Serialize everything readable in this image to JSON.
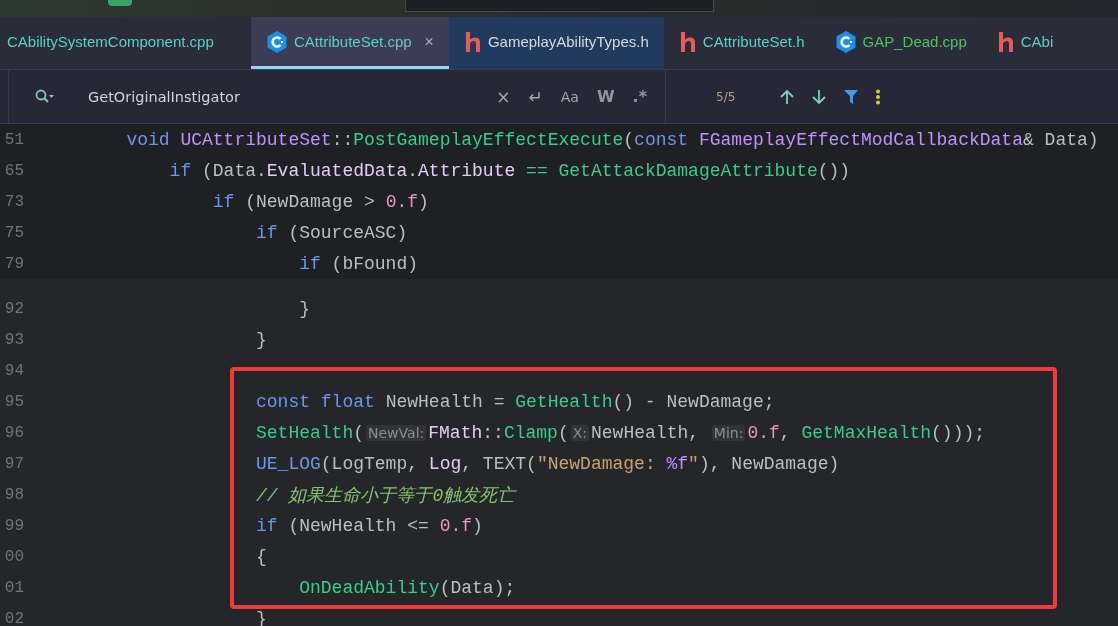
{
  "tabs": [
    {
      "label": "CAbilitySystemComponent.cpp",
      "kind": "plain",
      "selected": false,
      "highlighted": false,
      "color": "#5ccfc4"
    },
    {
      "label": "CAttributeSet.cpp",
      "kind": "cpp",
      "selected": true,
      "highlighted": false,
      "color": "#5ccfc4",
      "close": "×"
    },
    {
      "label": "GameplayAbilityTypes.h",
      "kind": "header",
      "selected": false,
      "highlighted": true,
      "color": "#d6dae0"
    },
    {
      "label": "CAttributeSet.h",
      "kind": "header",
      "selected": false,
      "highlighted": false,
      "color": "#5ccfc4"
    },
    {
      "label": "GAP_Dead.cpp",
      "kind": "cpp",
      "selected": false,
      "highlighted": false,
      "color": "#4cc55c"
    },
    {
      "label": "CAbi",
      "kind": "header",
      "selected": false,
      "highlighted": false,
      "color": "#5ccfc4"
    }
  ],
  "search": {
    "query": "GetOriginalInstigator",
    "clear": "×",
    "enter": "↵",
    "match_case": "Aa",
    "words": "W",
    "regex": ".*",
    "count": "5/5"
  },
  "sticky_lines": [
    {
      "number": "51",
      "tokens": [
        {
          "kind": "kw",
          "text": "void "
        },
        {
          "kind": "type",
          "text": "UCAttributeSet"
        },
        {
          "kind": "plain",
          "text": "::"
        },
        {
          "kind": "func",
          "text": "PostGameplayEffectExecute"
        },
        {
          "kind": "plain",
          "text": "("
        },
        {
          "kind": "kw",
          "text": "const "
        },
        {
          "kind": "type",
          "text": "FGameplayEffectModCallbackData"
        },
        {
          "kind": "plain",
          "text": "& Data)"
        }
      ],
      "children": [
        {
          "number": "65",
          "tokens": [
            {
              "kind": "kw",
              "text": "if "
            },
            {
              "kind": "plain",
              "text": "(Data."
            },
            {
              "kind": "field",
              "text": "EvaluatedData"
            },
            {
              "kind": "plain",
              "text": "."
            },
            {
              "kind": "field",
              "text": "Attribute"
            },
            {
              "kind": "func",
              "text": " == "
            },
            {
              "kind": "func",
              "text": "GetAttackDamageAttribute"
            },
            {
              "kind": "plain",
              "text": "())"
            }
          ],
          "children": [
            {
              "number": "73",
              "tokens": [
                {
                  "kind": "kw",
                  "text": "if "
                },
                {
                  "kind": "plain",
                  "text": "(NewDamage > "
                },
                {
                  "kind": "number",
                  "text": "0.f"
                },
                {
                  "kind": "plain",
                  "text": ")"
                }
              ],
              "children": [
                {
                  "number": "75",
                  "tokens": [
                    {
                      "kind": "kw",
                      "text": "if "
                    },
                    {
                      "kind": "plain",
                      "text": "(SourceASC)"
                    }
                  ],
                  "children": [
                    {
                      "number": "79",
                      "tokens": [
                        {
                          "kind": "kw",
                          "text": "if "
                        },
                        {
                          "kind": "plain",
                          "text": "(bFound)"
                        }
                      ]
                    }
                  ]
                }
              ]
            }
          ]
        }
      ]
    }
  ],
  "lines": [
    {
      "kind": "block_tail",
      "children": [
        {
          "number": "92",
          "tokens": [
            {
              "kind": "plain",
              "text": "}"
            }
          ]
        }
      ]
    },
    {
      "number": "93",
      "tokens": [
        {
          "kind": "plain",
          "text": "}"
        }
      ]
    },
    {
      "number": "94"
    },
    {
      "kind": "highlight",
      "children": [
        {
          "number": "95",
          "tokens": [
            {
              "kind": "kw",
              "text": "const float "
            },
            {
              "kind": "plain",
              "text": "NewHealth = "
            },
            {
              "kind": "func",
              "text": "GetHealth"
            },
            {
              "kind": "plain",
              "text": "() - NewDamage;"
            }
          ]
        },
        {
          "number": "96",
          "tokens": [
            {
              "kind": "func",
              "text": "SetHealth"
            },
            {
              "kind": "plain",
              "text": "("
            },
            {
              "kind": "hint",
              "text": "NewVal:"
            },
            {
              "kind": "field",
              "text": "FMath"
            },
            {
              "kind": "plain",
              "text": "::"
            },
            {
              "kind": "func",
              "text": "Clamp"
            },
            {
              "kind": "plain",
              "text": "("
            },
            {
              "kind": "hint",
              "text": "X:"
            },
            {
              "kind": "plain",
              "text": "NewHealth, "
            },
            {
              "kind": "hint",
              "text": "Min:"
            },
            {
              "kind": "number",
              "text": "0.f"
            },
            {
              "kind": "plain",
              "text": ", "
            },
            {
              "kind": "func",
              "text": "GetMaxHealth"
            },
            {
              "kind": "plain",
              "text": "()));"
            }
          ]
        },
        {
          "number": "97",
          "tokens": [
            {
              "kind": "macro",
              "text": "UE_LOG"
            },
            {
              "kind": "plain",
              "text": "(LogTemp, "
            },
            {
              "kind": "field",
              "text": "Log"
            },
            {
              "kind": "plain",
              "text": ", TEXT("
            },
            {
              "kind": "string",
              "text": "\"NewDamage: "
            },
            {
              "kind": "format",
              "text": "%f"
            },
            {
              "kind": "string",
              "text": "\""
            },
            {
              "kind": "plain",
              "text": "), NewDamage)"
            }
          ]
        },
        {
          "number": "98",
          "tokens": [
            {
              "kind": "comment",
              "text": "// 如果生命小于等于0触发死亡"
            }
          ]
        },
        {
          "number": "99",
          "tokens": [
            {
              "kind": "kw",
              "text": "if "
            },
            {
              "kind": "plain",
              "text": "(NewHealth <= "
            },
            {
              "kind": "number",
              "text": "0.f"
            },
            {
              "kind": "plain",
              "text": ")"
            }
          ]
        },
        {
          "number": "00",
          "tokens": [
            {
              "kind": "plain",
              "text": "{"
            }
          ],
          "children": [
            {
              "number": "01",
              "tokens": [
                {
                  "kind": "func",
                  "text": "OnDeadAbility"
                },
                {
                  "kind": "plain",
                  "text": "(Data);"
                }
              ]
            }
          ]
        }
      ]
    },
    {
      "number": "02",
      "tokens": [
        {
          "kind": "plain",
          "text": "}"
        }
      ]
    }
  ]
}
